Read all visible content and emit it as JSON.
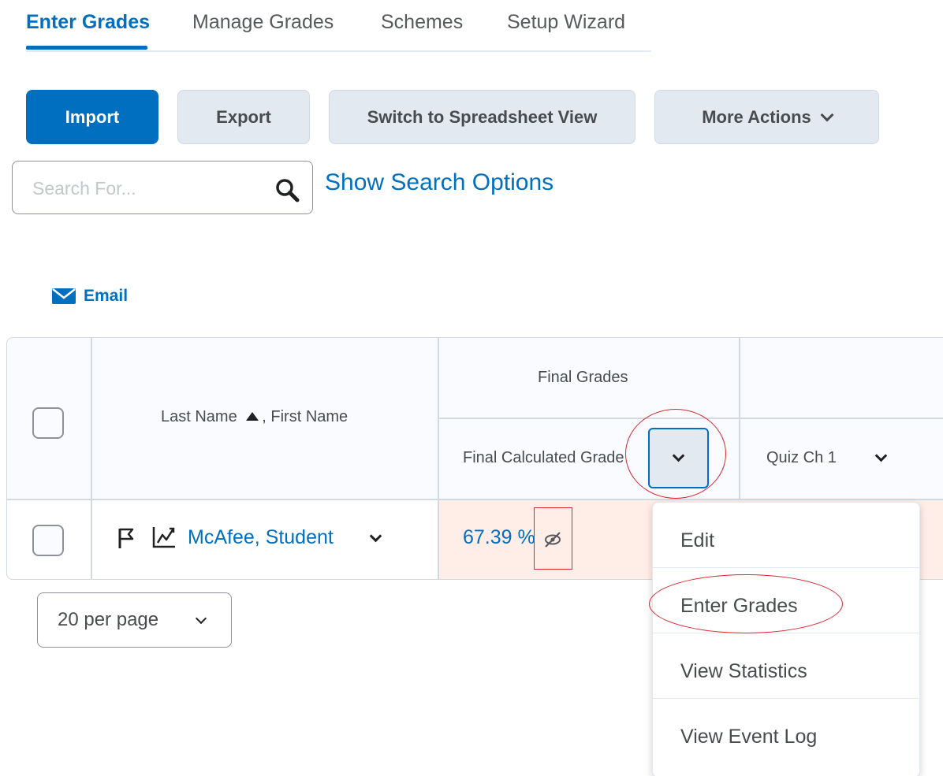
{
  "tabs": [
    {
      "label": "Enter Grades",
      "active": true
    },
    {
      "label": "Manage Grades",
      "active": false
    },
    {
      "label": "Schemes",
      "active": false
    },
    {
      "label": "Setup Wizard",
      "active": false
    }
  ],
  "toolbar": {
    "import_label": "Import",
    "export_label": "Export",
    "spreadsheet_label": "Switch to Spreadsheet View",
    "more_actions_label": "More Actions"
  },
  "search": {
    "placeholder": "Search For...",
    "value": "",
    "options_link": "Show Search Options"
  },
  "email_label": "Email",
  "table": {
    "name_header_last": "Last Name",
    "name_header_first": ", First Name",
    "group_header": "Final Grades",
    "final_calc_header": "Final Calculated Grade",
    "quiz_header": "Quiz Ch 1",
    "rows": [
      {
        "student": "McAfee, Student",
        "final_grade": "67.39 %"
      }
    ]
  },
  "pager": {
    "label": "20 per page"
  },
  "menu": {
    "items": [
      "Edit",
      "Enter Grades",
      "View Statistics",
      "View Event Log"
    ]
  },
  "colors": {
    "accent": "#006fbf",
    "annotation": "#d9262f",
    "grade_cell": "#ffede8"
  }
}
